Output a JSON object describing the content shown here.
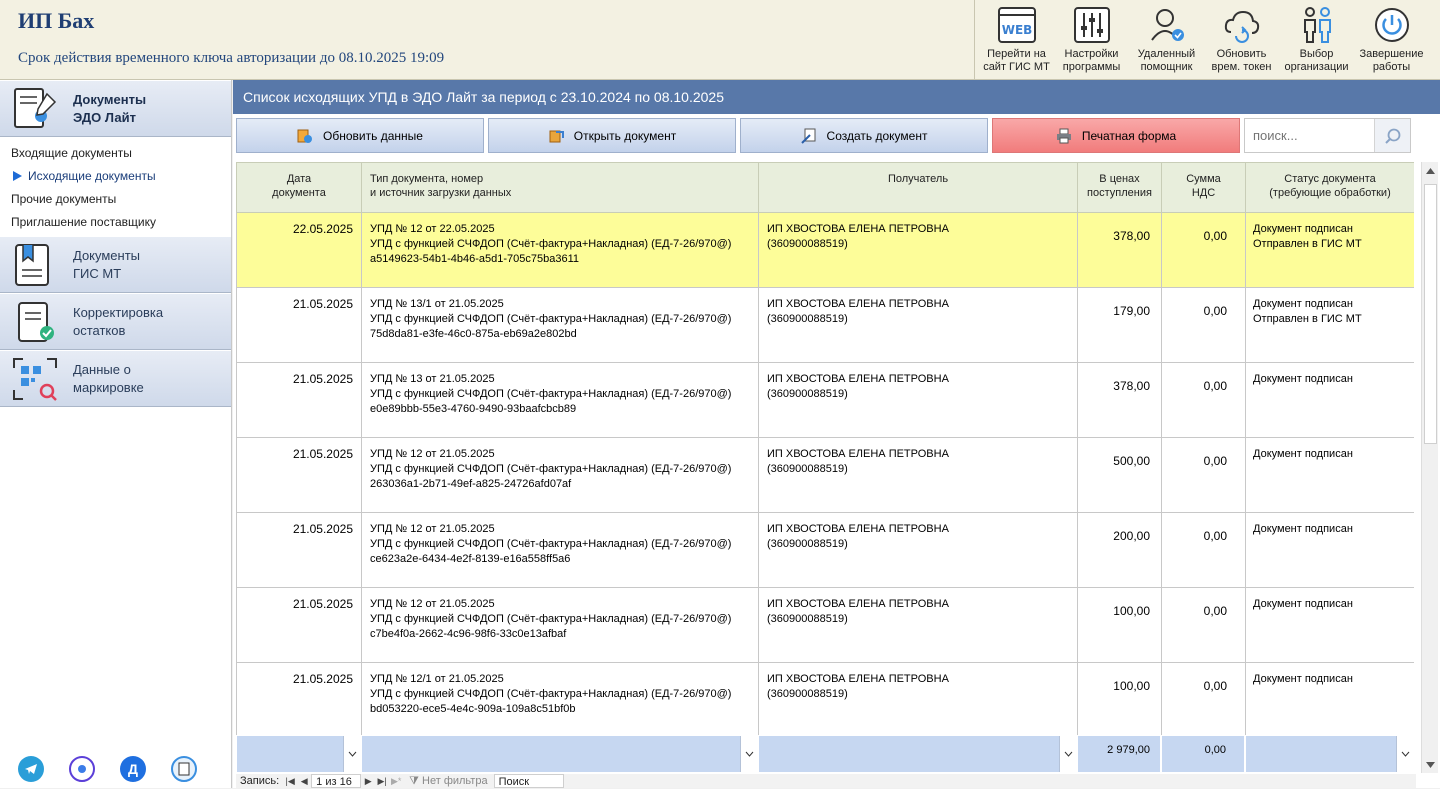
{
  "header": {
    "title": "ИП Бах",
    "key_notice": "Срок действия временного ключа авторизации до 08.10.2025 19:09"
  },
  "toolbar": [
    {
      "label": "Перейти на\nсайт ГИС МТ",
      "icon": "web-icon"
    },
    {
      "label": "Настройки\nпрограммы",
      "icon": "settings-sliders-icon"
    },
    {
      "label": "Удаленный\nпомощник",
      "icon": "remote-assistant-icon"
    },
    {
      "label": "Обновить\nврем. токен",
      "icon": "cloud-refresh-icon"
    },
    {
      "label": "Выбор\nорганизации",
      "icon": "people-icon"
    },
    {
      "label": "Завершение\nработы",
      "icon": "power-icon"
    }
  ],
  "sidebar": {
    "groups": [
      {
        "label": "Документы\nЭДО Лайт",
        "icon": "document-signature-icon"
      },
      {
        "label": "Документы\nГИС МТ",
        "icon": "document-bookmark-icon"
      },
      {
        "label": "Корректировка\nостатков",
        "icon": "document-check-icon"
      },
      {
        "label": "Данные о\nмаркировке",
        "icon": "qr-search-icon"
      }
    ],
    "sub_items": [
      "Входящие документы",
      "Исходящие документы",
      "Прочие документы",
      "Приглашение поставщику"
    ],
    "active_sub": "Исходящие документы"
  },
  "main": {
    "title": "Список исходящих УПД в ЭДО Лайт за период с 23.10.2024 по 08.10.2025",
    "actions": {
      "refresh": "Обновить данные",
      "open": "Открыть документ",
      "create": "Создать документ",
      "print": "Печатная форма"
    },
    "search_placeholder": "поиск...",
    "columns": [
      "Дата\nдокумента",
      "Тип документа, номер\nи источник загрузки данных",
      "Получатель",
      "В ценах\nпоступления",
      "Сумма\nНДС",
      "Статус документа\n(требующие обработки)"
    ],
    "rows": [
      {
        "date": "22.05.2025",
        "doc_line1": "УПД № 12 от 22.05.2025",
        "doc_line2": "УПД с функцией СЧФДОП (Счёт-фактура+Накладная) (ЕД-7-26/970@)",
        "doc_id": "a5149623-54b1-4b46-a5d1-705c75ba3611",
        "recipient": "ИП ХВОСТОВА ЕЛЕНА ПЕТРОВНА",
        "inn": "(360900088519)",
        "price": "378,00",
        "vat": "0,00",
        "status1": "Документ подписан",
        "status2": "Отправлен в ГИС МТ"
      },
      {
        "date": "21.05.2025",
        "doc_line1": "УПД № 13/1 от 21.05.2025",
        "doc_line2": "УПД с функцией СЧФДОП (Счёт-фактура+Накладная) (ЕД-7-26/970@)",
        "doc_id": "75d8da81-e3fe-46c0-875a-eb69a2e802bd",
        "recipient": "ИП ХВОСТОВА ЕЛЕНА ПЕТРОВНА",
        "inn": "(360900088519)",
        "price": "179,00",
        "vat": "0,00",
        "status1": "Документ подписан",
        "status2": "Отправлен в ГИС МТ"
      },
      {
        "date": "21.05.2025",
        "doc_line1": "УПД № 13 от 21.05.2025",
        "doc_line2": "УПД с функцией СЧФДОП (Счёт-фактура+Накладная) (ЕД-7-26/970@)",
        "doc_id": "e0e89bbb-55e3-4760-9490-93baafcbcb89",
        "recipient": "ИП ХВОСТОВА ЕЛЕНА ПЕТРОВНА",
        "inn": "(360900088519)",
        "price": "378,00",
        "vat": "0,00",
        "status1": "Документ подписан",
        "status2": ""
      },
      {
        "date": "21.05.2025",
        "doc_line1": "УПД № 12 от 21.05.2025",
        "doc_line2": "УПД с функцией СЧФДОП (Счёт-фактура+Накладная) (ЕД-7-26/970@)",
        "doc_id": "263036a1-2b71-49ef-a825-24726afd07af",
        "recipient": "ИП ХВОСТОВА ЕЛЕНА ПЕТРОВНА",
        "inn": "(360900088519)",
        "price": "500,00",
        "vat": "0,00",
        "status1": "Документ подписан",
        "status2": ""
      },
      {
        "date": "21.05.2025",
        "doc_line1": "УПД № 12 от 21.05.2025",
        "doc_line2": "УПД с функцией СЧФДОП (Счёт-фактура+Накладная) (ЕД-7-26/970@)",
        "doc_id": "ce623a2e-6434-4e2f-8139-e16a558ff5a6",
        "recipient": "ИП ХВОСТОВА ЕЛЕНА ПЕТРОВНА",
        "inn": "(360900088519)",
        "price": "200,00",
        "vat": "0,00",
        "status1": "Документ подписан",
        "status2": ""
      },
      {
        "date": "21.05.2025",
        "doc_line1": "УПД № 12 от 21.05.2025",
        "doc_line2": "УПД с функцией СЧФДОП (Счёт-фактура+Накладная) (ЕД-7-26/970@)",
        "doc_id": "c7be4f0a-2662-4c96-98f6-33c0e13afbaf",
        "recipient": "ИП ХВОСТОВА ЕЛЕНА ПЕТРОВНА",
        "inn": "(360900088519)",
        "price": "100,00",
        "vat": "0,00",
        "status1": "Документ подписан",
        "status2": ""
      },
      {
        "date": "21.05.2025",
        "doc_line1": "УПД № 12/1 от 21.05.2025",
        "doc_line2": "УПД с функцией СЧФДОП (Счёт-фактура+Накладная) (ЕД-7-26/970@)",
        "doc_id": "bd053220-ece5-4e4c-909a-109a8c51bf0b",
        "recipient": "ИП ХВОСТОВА ЕЛЕНА ПЕТРОВНА",
        "inn": "(360900088519)",
        "price": "100,00",
        "vat": "0,00",
        "status1": "Документ подписан",
        "status2": ""
      }
    ],
    "totals": {
      "price": "2 979,00",
      "vat": "0,00"
    },
    "statusbar": {
      "records_label": "Запись:",
      "position": "1 из 16",
      "filter": "Нет фильтра",
      "search": "Поиск"
    }
  },
  "colors": {
    "title_bar": "#5878a9",
    "selected_row": "#fdfd99",
    "print_button": "#f17c7c",
    "header_bg": "#f3f1e2"
  }
}
